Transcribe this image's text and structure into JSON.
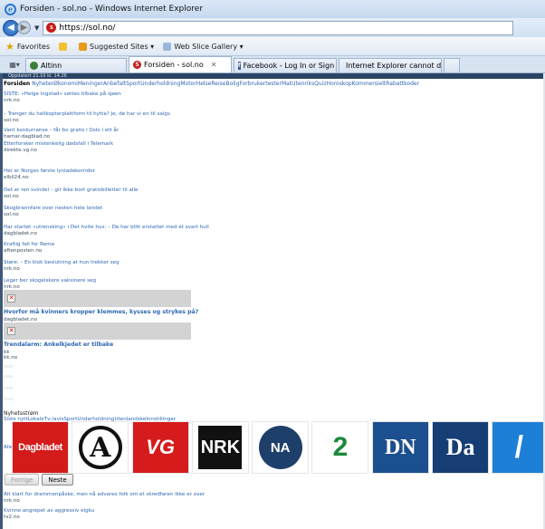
{
  "window": {
    "title": "Forsiden - sol.no - Windows Internet Explorer"
  },
  "address": {
    "url": "https://sol.no/"
  },
  "favbar": {
    "favorites_label": "Favorites",
    "suggested_label": "Suggested Sites ▾",
    "webslice_label": "Web Slice Gallery ▾"
  },
  "tabs": [
    {
      "label": "Altinn"
    },
    {
      "label": "Forsiden - sol.no"
    },
    {
      "label": "Facebook - Log In or Sign ..."
    },
    {
      "label": "Internet Explorer cannot di..."
    }
  ],
  "page": {
    "strip_text": "Oppdatert 21.10 kl. 14.26",
    "nav": {
      "current": "Forsiden",
      "items": [
        "Nyheter",
        "Økonomi",
        "Meninger",
        "Anbefalt",
        "Sport",
        "Underholdning",
        "Motor",
        "Helse",
        "Reise",
        "Bolig",
        "Forbrukertester",
        "Mat",
        "Utenriks",
        "Quiz",
        "Horoskop",
        "Kommersielt",
        "Rabattkoder"
      ]
    },
    "articles": [
      {
        "h": "SISTE: «Helge Ingstad» settes tilbake på sjøen",
        "s": "nrk.no"
      },
      {
        "h": "– Trenger du helikopterplattform til hytta? Je, de har vi en til salgs",
        "s": "sol.no"
      },
      {
        "h": "Vant konkurranse – får bo gratis i Oslo i ett år",
        "s": "hamar-dagblad.no"
      },
      {
        "h": "Etterforsker mistenkelig dødsfall i Telemark",
        "s": "direkte.vg.no"
      },
      {
        "h": "Her er Norges første lynladekorridor",
        "s": "elbil24.no"
      },
      {
        "h": "Det er ren svindel – gir ikke bort gratisbilletter til alle",
        "s": "sol.no"
      },
      {
        "h": "Skogbrannfare over nesten hele landet",
        "s": "sol.no"
      },
      {
        "h": "Har startet «utrensking» i Det hvite hus: – De har blitt erstattet med et svart hull",
        "s": "dagbladet.no"
      },
      {
        "h": "Kraftig fall for Reme",
        "s": "aftenposten.no"
      },
      {
        "h": "Støre: – En klok beslutning at hun trekker seg",
        "s": "nrk.no"
      },
      {
        "h": "Leger ber skogelskere vaksinere seg",
        "s": "nrk.no"
      }
    ],
    "featured": [
      {
        "h": "Hvorfor må kvinners kropper klemmes, kysses og strykes på?",
        "s": "dagbladet.no"
      },
      {
        "h": "Trendalarm: Ankelkjedet er tilbake",
        "s1": "kk",
        "s2": "kk.no"
      }
    ],
    "newsstream": {
      "title": "Nyhetsstrøm",
      "links": "Siste nyttLokaleTv-/avisSportUnderholdningUtenlandskeInnstillinger",
      "alle": "Alle"
    },
    "logos": [
      {
        "name": "Dagbladet",
        "bg": "#d31b1b",
        "fg": "#ffffff"
      },
      {
        "name": "A",
        "bg": "#ffffff",
        "fg": "#111111"
      },
      {
        "name": "VG",
        "bg": "#d51b1b",
        "fg": "#ffffff"
      },
      {
        "name": "NRK",
        "bg": "#111111",
        "fg": "#ffffff"
      },
      {
        "name": "NA",
        "bg": "#1f3f6b",
        "fg": "#ffffff"
      },
      {
        "name": "2",
        "bg": "#ffffff",
        "fg": "#1a8a3a"
      },
      {
        "name": "DN",
        "bg": "#1c4f8f",
        "fg": "#ffffff"
      },
      {
        "name": "Da",
        "bg": "#163e74",
        "fg": "#ffffff"
      },
      {
        "name": "/",
        "bg": "#1e7fd6",
        "fg": "#ffffff"
      }
    ],
    "pager": {
      "prev": "Forrige",
      "next": "Neste"
    },
    "bottom_articles": [
      {
        "h": "Alt klart for drammenpåske, men nå advares folk om et skredfaren ikke er over",
        "s": "nrk.no"
      },
      {
        "h": "Kvinne angrepet av aggressiv elgku",
        "s": "tv2.no"
      }
    ]
  },
  "colors": {
    "link": "#2e68b3",
    "strip": "#2a4465"
  }
}
